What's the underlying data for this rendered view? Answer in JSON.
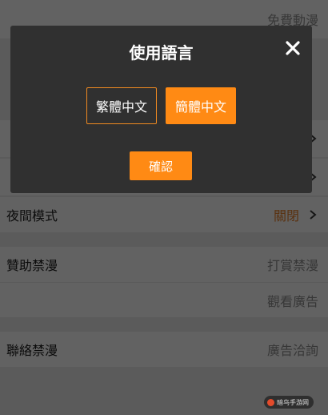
{
  "settings": {
    "rows": [
      {
        "label": "",
        "value": "免費動漫",
        "chevron": false
      },
      {
        "label": "夜間模式",
        "value": "關閉",
        "chevron": true
      },
      {
        "label": "贊助禁漫",
        "value": "打賞禁漫",
        "chevron": false
      },
      {
        "label": "",
        "value": "觀看廣告",
        "chevron": false
      },
      {
        "label": "聯絡禁漫",
        "value": "廣告洽詢",
        "chevron": false
      }
    ]
  },
  "modal": {
    "title": "使用語言",
    "close_icon": "close-icon",
    "languages": [
      {
        "label": "繁體中文",
        "selected": false
      },
      {
        "label": "簡體中文",
        "selected": true
      }
    ],
    "confirm_label": "確認"
  },
  "colors": {
    "accent": "#ff8a14",
    "modal_bg": "#303030",
    "overlay": "rgba(0,0,0,0.35)"
  },
  "watermark": {
    "text": "暗鸟手游网"
  }
}
